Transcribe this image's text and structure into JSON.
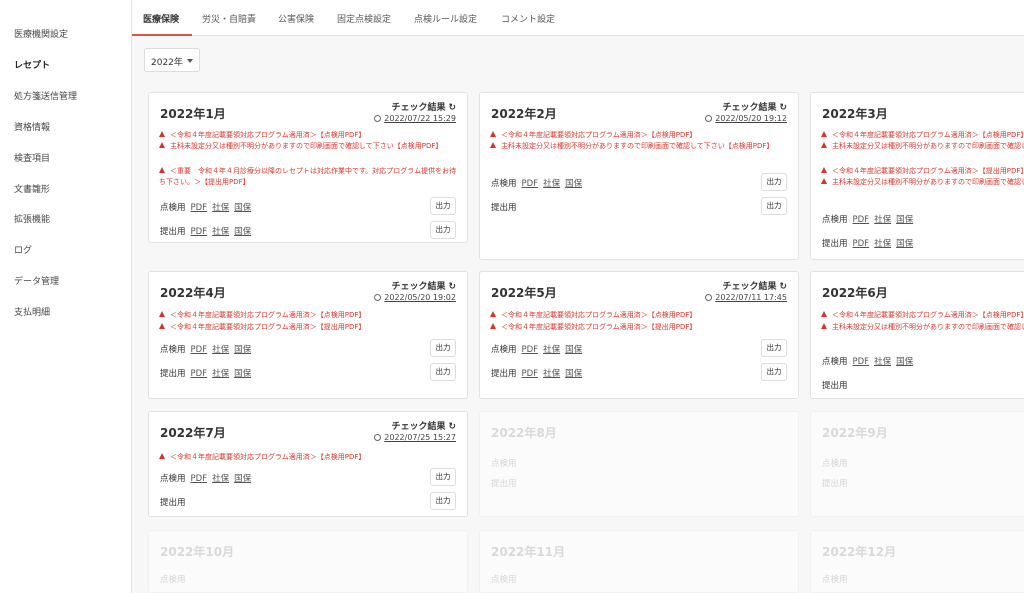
{
  "sidebar": {
    "items": [
      "医療機関設定",
      "レセプト",
      "処方箋送信管理",
      "資格情報",
      "検査項目",
      "文書雛形",
      "拡張機能",
      "ログ",
      "データ管理",
      "支払明細"
    ],
    "active": "レセプト"
  },
  "tabs": [
    "医療保険",
    "労災・自賠責",
    "公害保険",
    "固定点検設定",
    "点検ルール設定",
    "コメント設定"
  ],
  "year_select": "2022年",
  "labels": {
    "check": "チェック結果",
    "tenken": "点検用",
    "teishutsu": "提出用",
    "pdf": "PDF",
    "shaho": "社保",
    "kokuho": "国保",
    "output": "出力"
  },
  "warnings": {
    "w1": "＜令和４年度記載要領対応プログラム適用済＞【点検用PDF】",
    "w2": "主科未設定分又は種別不明分がありますので印刷画面で確認して下さい【点検用PDF】",
    "w3": "＜重要　令和４年４月診療分以降のレセプトは対応作業中です。対応プログラム提供をお待ち下さい。＞【提出用PDF】",
    "w4": "＜令和４年度記載要領対応プログラム適用済＞【提出用PDF】",
    "w2b": "主科未設定分又は種別不明分がありますので印刷画面で確認して下さい【点検用PDF】",
    "w6a": "＜令和４年度記載要領対応プログラム適用済＞【点検用PDF】",
    "w6b": "主科未設定分又は種別不明分がありますので印刷画面で確認して下さい【点検用PDF】"
  },
  "cards": {
    "c1": {
      "month": "2022年1月",
      "date": "2022/07/22 15:29"
    },
    "c2": {
      "month": "2022年2月",
      "date": "2022/05/20 19:12"
    },
    "c3": {
      "month": "2022年3月"
    },
    "c4": {
      "month": "2022年4月",
      "date": "2022/05/20 19:02"
    },
    "c5": {
      "month": "2022年5月",
      "date": "2022/07/11 17:45"
    },
    "c6": {
      "month": "2022年6月"
    },
    "c7": {
      "month": "2022年7月",
      "date": "2022/07/25 15:27"
    },
    "c8": {
      "month": "2022年8月"
    },
    "c9": {
      "month": "2022年9月"
    },
    "c10": {
      "month": "2022年10月"
    },
    "c11": {
      "month": "2022年11月"
    },
    "c12": {
      "month": "2022年12月"
    }
  },
  "colors": {
    "accent": "#d9534f",
    "warning": "#d9342b"
  }
}
